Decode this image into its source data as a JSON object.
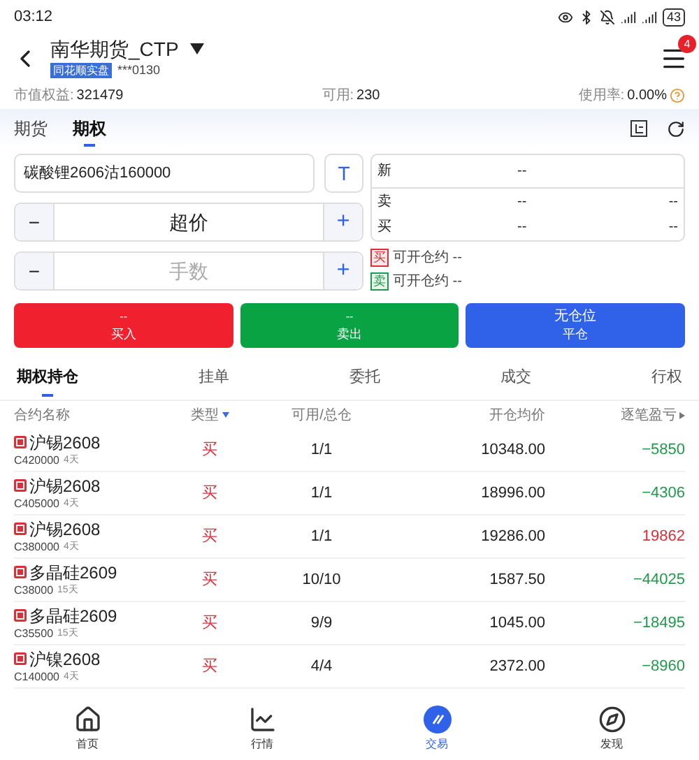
{
  "status_bar": {
    "time": "03:12",
    "battery": "43"
  },
  "header": {
    "title": "南华期货_CTP",
    "tag": "同花顺实盘",
    "account": "***0130",
    "badge": "4"
  },
  "stats": [
    {
      "label": "市值权益:",
      "value": "321479"
    },
    {
      "label": "可用:",
      "value": "230"
    },
    {
      "label": "使用率:",
      "value": "0.00%"
    }
  ],
  "tabs": [
    {
      "label": "期货",
      "selected": false
    },
    {
      "label": "期权",
      "selected": true
    }
  ],
  "order": {
    "contract": "碳酸锂2606沽160000",
    "t_button": "T",
    "minus": "−",
    "plus": "+",
    "price": "超价",
    "qty_placeholder": "手数"
  },
  "quote": {
    "new_label": "新",
    "new_value": "--",
    "rows": [
      {
        "label": "卖",
        "price": "--",
        "volume": "--"
      },
      {
        "label": "买",
        "price": "--",
        "volume": "--"
      }
    ]
  },
  "openable": [
    {
      "side": "买",
      "kind": "buy",
      "text": "可开仓约 --"
    },
    {
      "side": "卖",
      "kind": "sell",
      "text": "可开仓约 --"
    }
  ],
  "actions": [
    {
      "kind": "buy",
      "top": "--",
      "label": "买入"
    },
    {
      "kind": "sell",
      "top": "--",
      "label": "卖出"
    },
    {
      "kind": "close",
      "top": "无仓位",
      "label": "平仓"
    }
  ],
  "position_tabs": [
    {
      "label": "期权持仓",
      "selected": true
    },
    {
      "label": "挂单",
      "selected": false
    },
    {
      "label": "委托",
      "selected": false
    },
    {
      "label": "成交",
      "selected": false
    },
    {
      "label": "行权",
      "selected": false
    }
  ],
  "columns": [
    "合约名称",
    "类型",
    "可用/总仓",
    "开仓均价",
    "逐笔盈亏"
  ],
  "rows": [
    {
      "name": "沪锡2608",
      "code": "C420000",
      "days": "4天",
      "type": "买",
      "avail": "1/1",
      "price": "10348.00",
      "pnl": "−5850",
      "profit": false
    },
    {
      "name": "沪锡2608",
      "code": "C405000",
      "days": "4天",
      "type": "买",
      "avail": "1/1",
      "price": "18996.00",
      "pnl": "−4306",
      "profit": false
    },
    {
      "name": "沪锡2608",
      "code": "C380000",
      "days": "4天",
      "type": "买",
      "avail": "1/1",
      "price": "19286.00",
      "pnl": "19862",
      "profit": true
    },
    {
      "name": "多晶硅2609",
      "code": "C38000",
      "days": "15天",
      "type": "买",
      "avail": "10/10",
      "price": "1587.50",
      "pnl": "−44025",
      "profit": false
    },
    {
      "name": "多晶硅2609",
      "code": "C35500",
      "days": "15天",
      "type": "买",
      "avail": "9/9",
      "price": "1045.00",
      "pnl": "−18495",
      "profit": false
    },
    {
      "name": "沪镍2608",
      "code": "C140000",
      "days": "4天",
      "type": "买",
      "avail": "4/4",
      "price": "2372.00",
      "pnl": "−8960",
      "profit": false
    }
  ],
  "nav": [
    {
      "label": "首页",
      "kind": "home",
      "selected": false
    },
    {
      "label": "行情",
      "kind": "chart",
      "selected": false
    },
    {
      "label": "交易",
      "kind": "trade",
      "selected": true
    },
    {
      "label": "发现",
      "kind": "discover",
      "selected": false
    }
  ]
}
